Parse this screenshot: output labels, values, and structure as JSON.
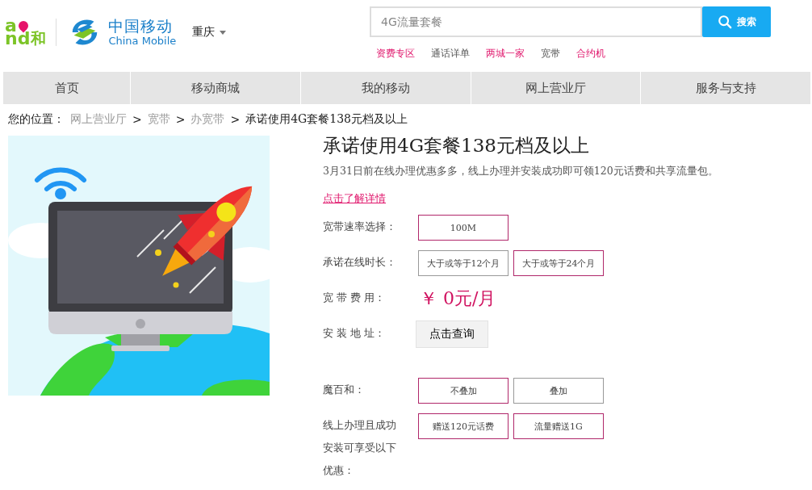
{
  "header": {
    "and_logo": {
      "top": "a",
      "bottom": "nd",
      "suffix": "和"
    },
    "brand": {
      "cn": "中国移动",
      "en": "China Mobile"
    },
    "city": "重庆"
  },
  "search": {
    "placeholder": "4G流量套餐",
    "button": "搜索"
  },
  "quick_links": [
    {
      "label": "资费专区",
      "highlighted": true
    },
    {
      "label": "通话详单",
      "highlighted": false
    },
    {
      "label": "两城一家",
      "highlighted": true
    },
    {
      "label": "宽带",
      "highlighted": false
    },
    {
      "label": "合约机",
      "highlighted": true
    }
  ],
  "nav": [
    {
      "label": "首页"
    },
    {
      "label": "移动商城"
    },
    {
      "label": "我的移动"
    },
    {
      "label": "网上营业厅"
    },
    {
      "label": "服务与支持"
    }
  ],
  "breadcrumb": {
    "prefix": "您的位置：",
    "links": [
      "网上营业厅",
      "宽带",
      "办宽带"
    ],
    "separator": ">",
    "current": "承诺使用4G套餐138元档及以上"
  },
  "product": {
    "title": "承诺使用4G套餐138元档及以上",
    "subtitle": "3月31日前在线办理优惠多多，线上办理并安装成功即可领120元话费和共享流量包。",
    "detail_link": "点击了解详情",
    "rows": [
      {
        "kind": "options",
        "label": "宽带速率选择：",
        "options": [
          {
            "label": "100M",
            "selected": true
          }
        ]
      },
      {
        "kind": "options",
        "label": "承诺在线时长：",
        "options": [
          {
            "label": "大于或等于12个月",
            "selected": false
          },
          {
            "label": "大于或等于24个月",
            "selected": true
          }
        ]
      },
      {
        "kind": "price",
        "label": "宽 带 费 用：",
        "value": "￥ 0元/月"
      },
      {
        "kind": "button",
        "label": "安 装 地 址：",
        "button": "点击查询"
      },
      {
        "kind": "options",
        "label": "魔百和：",
        "options": [
          {
            "label": "不叠加",
            "selected": true
          },
          {
            "label": "叠加",
            "selected": false
          }
        ]
      },
      {
        "kind": "options",
        "label": "线上办理且成功安装可享受以下优惠：",
        "options": [
          {
            "label": "赠送120元话费",
            "selected": true
          },
          {
            "label": "流量赠送1G",
            "selected": true
          }
        ]
      }
    ]
  }
}
